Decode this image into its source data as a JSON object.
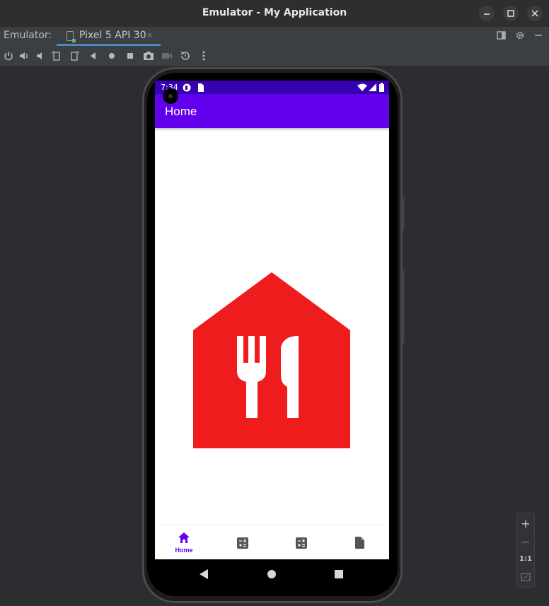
{
  "window": {
    "title": "Emulator - My Application",
    "controls": [
      "minimize-icon",
      "maximize-icon",
      "close-icon"
    ]
  },
  "tabbar": {
    "label": "Emulator:",
    "tab_name": "Pixel 5 API 30",
    "tab_close": "×"
  },
  "toolbar": {
    "icons": [
      "power-icon",
      "volume-up-icon",
      "volume-down-icon",
      "rotate-left-icon",
      "rotate-right-icon",
      "back-icon",
      "home-icon",
      "overview-icon",
      "screenshot-icon",
      "record-icon",
      "snapshot-icon",
      "more-icon"
    ]
  },
  "device": {
    "status_time": "7:34",
    "app_title": "Home",
    "bottom_nav": [
      {
        "label": "Home",
        "icon": "home-icon",
        "selected": true
      },
      {
        "label": "",
        "icon": "calculator-icon",
        "selected": false
      },
      {
        "label": "",
        "icon": "calculator-icon",
        "selected": false
      },
      {
        "label": "",
        "icon": "document-icon",
        "selected": false
      }
    ],
    "colors": {
      "status_bar": "#3700b3",
      "app_bar": "#6200ee",
      "logo": "#ee1c1c",
      "nav_selected": "#6200ee",
      "nav_unselected": "#555555"
    }
  },
  "zoom": {
    "zoom_in": "+",
    "zoom_out": "−",
    "actual_size": "1:1"
  }
}
